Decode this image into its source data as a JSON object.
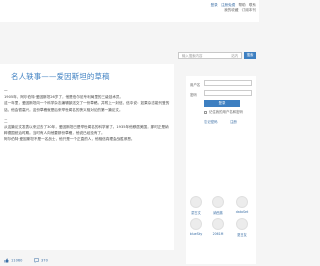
{
  "header": {
    "links_line1": [
      "登录",
      "注册免费",
      "帮助",
      "联系"
    ],
    "links_line2": [
      "我的收藏",
      "订阅本刊"
    ]
  },
  "search": {
    "placeholder": "输入搜索内容",
    "hint": "站内",
    "button": "搜索"
  },
  "article": {
    "title": "名人轶事——爱因斯坦的草稿",
    "paragraphs": [
      "一",
      "1905年，阿尔伯特·爱因斯坦26岁了，他是伯尔尼专利局里的三级技术员。",
      "这一年里，爱因斯坦向一个科学杂志编辑部送交了一份草稿，并附上一封信，信中说：如果杂志能刊登的话，他会很高兴。这份草稿就是后来举世闻名的狭义相对论的第一篇论文。",
      "二",
      "从这篇论文发表以来过去了30年，爱因斯坦已是举世闻名的科学家了。1935年他移居美国，那时正是纳粹德国统治时期。当时有人向他要那份草稿，他说已经没有了。",
      "阿尔伯特·爱因斯坦不是一名战士，他只是一个正直的人，他相信真理会战胜邪恶。"
    ]
  },
  "login": {
    "user_label": "用户名",
    "pass_label": "密码",
    "submit": "登录",
    "remember": "记住我的用户名和密码",
    "forgot": "忘记密码",
    "register": "注册"
  },
  "sidebar_avatars": [
    {
      "name": "蒙古文"
    },
    {
      "name": "纳西族"
    },
    {
      "name": "dataSet"
    },
    {
      "name": "blueSky"
    },
    {
      "name": "2061M"
    },
    {
      "name": "夏日友"
    }
  ],
  "footer": {
    "count1": "11060",
    "count2": "370"
  }
}
